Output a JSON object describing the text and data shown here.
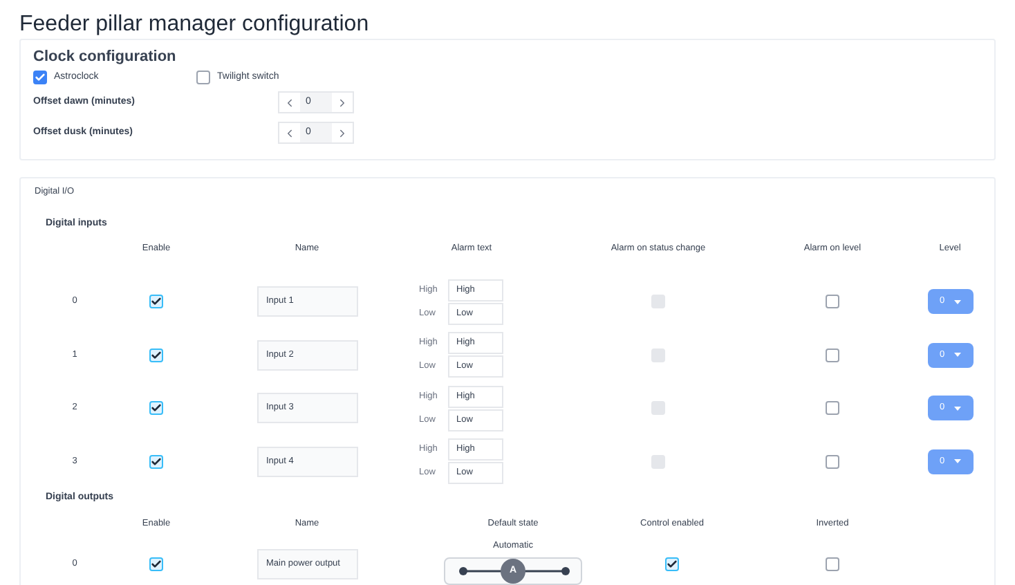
{
  "title": "Feeder pillar manager configuration",
  "clock": {
    "title": "Clock configuration",
    "options": [
      {
        "label": "Astroclock",
        "checked": true
      },
      {
        "label": "Twilight switch",
        "checked": false
      }
    ],
    "offsets": [
      {
        "label": "Offset dawn (minutes)",
        "value": "0"
      },
      {
        "label": "Offset dusk (minutes)",
        "value": "0"
      }
    ]
  },
  "digital_io": {
    "title": "Digital I/O",
    "inputs": {
      "title": "Digital inputs",
      "columns": [
        "Enable",
        "Name",
        "Alarm text",
        "Alarm on status change",
        "Alarm on level",
        "Level"
      ],
      "rows": [
        {
          "index": "0",
          "enabled": true,
          "name": "Input 1",
          "high_label": "High",
          "high": "High",
          "low_label": "Low",
          "low": "Low",
          "status_change": {
            "checked": false,
            "disabled": true
          },
          "on_level": {
            "checked": false
          },
          "level": "0"
        },
        {
          "index": "1",
          "enabled": true,
          "name": "Input 2",
          "high_label": "High",
          "high": "High",
          "low_label": "Low",
          "low": "Low",
          "status_change": {
            "checked": false,
            "disabled": true
          },
          "on_level": {
            "checked": false
          },
          "level": "0"
        },
        {
          "index": "2",
          "enabled": true,
          "name": "Input 3",
          "high_label": "High",
          "high": "High",
          "low_label": "Low",
          "low": "Low",
          "status_change": {
            "checked": false,
            "disabled": true
          },
          "on_level": {
            "checked": false
          },
          "level": "0"
        },
        {
          "index": "3",
          "enabled": true,
          "name": "Input 4",
          "high_label": "High",
          "high": "High",
          "low_label": "Low",
          "low": "Low",
          "status_change": {
            "checked": false,
            "disabled": true
          },
          "on_level": {
            "checked": false
          },
          "level": "0"
        }
      ]
    },
    "outputs": {
      "title": "Digital outputs",
      "columns": [
        "Enable",
        "Name",
        "Default state",
        "Control enabled",
        "Inverted"
      ],
      "rows": [
        {
          "index": "0",
          "enabled": true,
          "name": "Main power output",
          "default_state_label": "Automatic",
          "switch_text": "A",
          "level": 0.5,
          "control_enabled": true,
          "inverted": false
        }
      ]
    }
  }
}
